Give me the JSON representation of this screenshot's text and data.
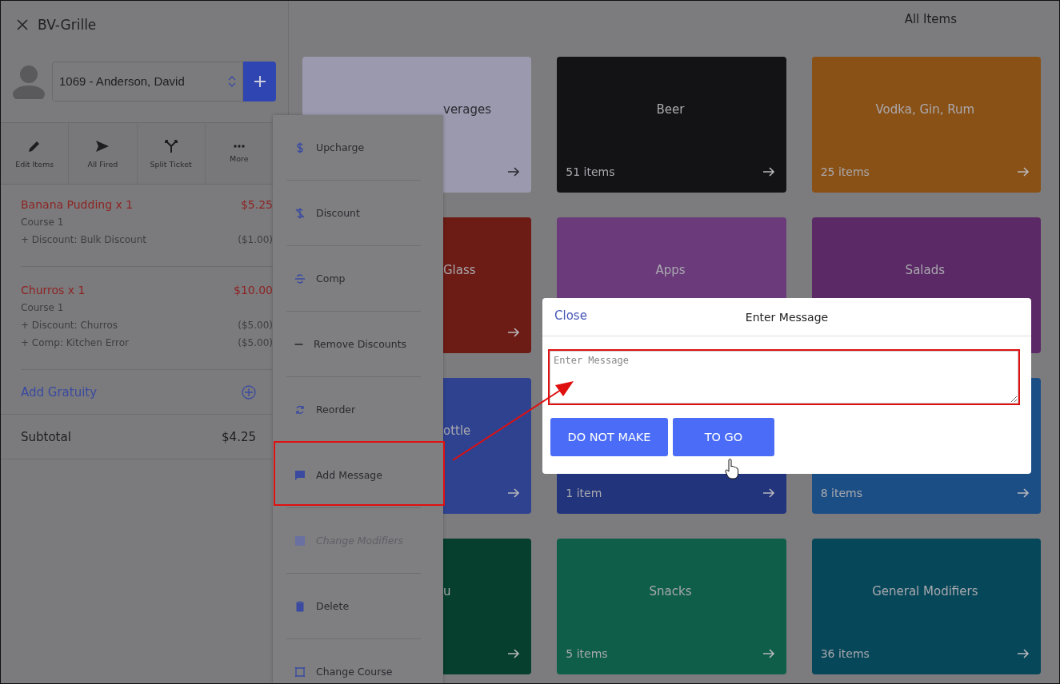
{
  "title": "BV-Grille",
  "customer": {
    "value": "1069 - Anderson, David"
  },
  "toolbar": [
    {
      "label": "Edit Items"
    },
    {
      "label": "All Fired"
    },
    {
      "label": "Split Ticket"
    },
    {
      "label": "More"
    }
  ],
  "ticket_items": [
    {
      "name": "Banana Pudding x 1",
      "price": "$5.25",
      "course": "Course 1",
      "adjustments": [
        {
          "label": "+ Discount: Bulk Discount",
          "amount": "($1.00)"
        }
      ]
    },
    {
      "name": "Churros x 1",
      "price": "$10.00",
      "course": "Course 1",
      "adjustments": [
        {
          "label": "+ Discount: Churros",
          "amount": "($5.00)"
        },
        {
          "label": "+ Comp: Kitchen Error",
          "amount": "($5.00)"
        }
      ]
    }
  ],
  "gratuity": {
    "label": "Add Gratuity"
  },
  "subtotal": {
    "label": "Subtotal",
    "value": "$4.25"
  },
  "header": "All Items",
  "categories": [
    {
      "kind": "partial",
      "title": "verages",
      "arrow": true,
      "color": "#9b99ae"
    },
    {
      "kind": "full",
      "title": "Beer",
      "count": "51 items",
      "arrow": true,
      "color": "#131316"
    },
    {
      "kind": "full",
      "title": "Vodka, Gin, Rum",
      "count": "25 items",
      "arrow": true,
      "color": "#8a5116"
    },
    {
      "kind": "partial",
      "title": "Glass",
      "arrow": true,
      "color": "#6d1b15"
    },
    {
      "kind": "full",
      "title": "Apps",
      "arrow": false,
      "color": "#6b3a7b"
    },
    {
      "kind": "full",
      "title": "Salads",
      "arrow": false,
      "color": "#5b2966"
    },
    {
      "kind": "partial",
      "title": "ottle",
      "arrow": true,
      "color": "#2f4290"
    },
    {
      "kind": "full",
      "count": "1 item",
      "arrow": true,
      "color": "#22347c"
    },
    {
      "kind": "full",
      "count": "8 items",
      "arrow": true,
      "color": "#1c4e86"
    },
    {
      "kind": "partial",
      "title": "u",
      "arrow": true,
      "color": "#063f2e"
    },
    {
      "kind": "full",
      "title": "Snacks",
      "count": "5 items",
      "arrow": true,
      "color": "#0f5e4a"
    },
    {
      "kind": "full",
      "title": "General Modifiers",
      "count": "36 items",
      "arrow": true,
      "color": "#064759"
    }
  ],
  "menu": [
    {
      "label": "Upcharge",
      "disabled": false
    },
    {
      "label": "Discount",
      "disabled": false
    },
    {
      "label": "Comp",
      "disabled": false
    },
    {
      "label": "Remove Discounts",
      "disabled": false
    },
    {
      "label": "Reorder",
      "disabled": false
    },
    {
      "label": "Add Message",
      "disabled": false
    },
    {
      "label": "Change Modifiers",
      "disabled": true
    },
    {
      "label": "Delete",
      "disabled": false
    },
    {
      "label": "Change Course",
      "disabled": false
    }
  ],
  "dialog": {
    "close": "Close",
    "title": "Enter Message",
    "placeholder": "Enter Message",
    "buttons": [
      "DO NOT MAKE",
      "TO GO"
    ]
  }
}
